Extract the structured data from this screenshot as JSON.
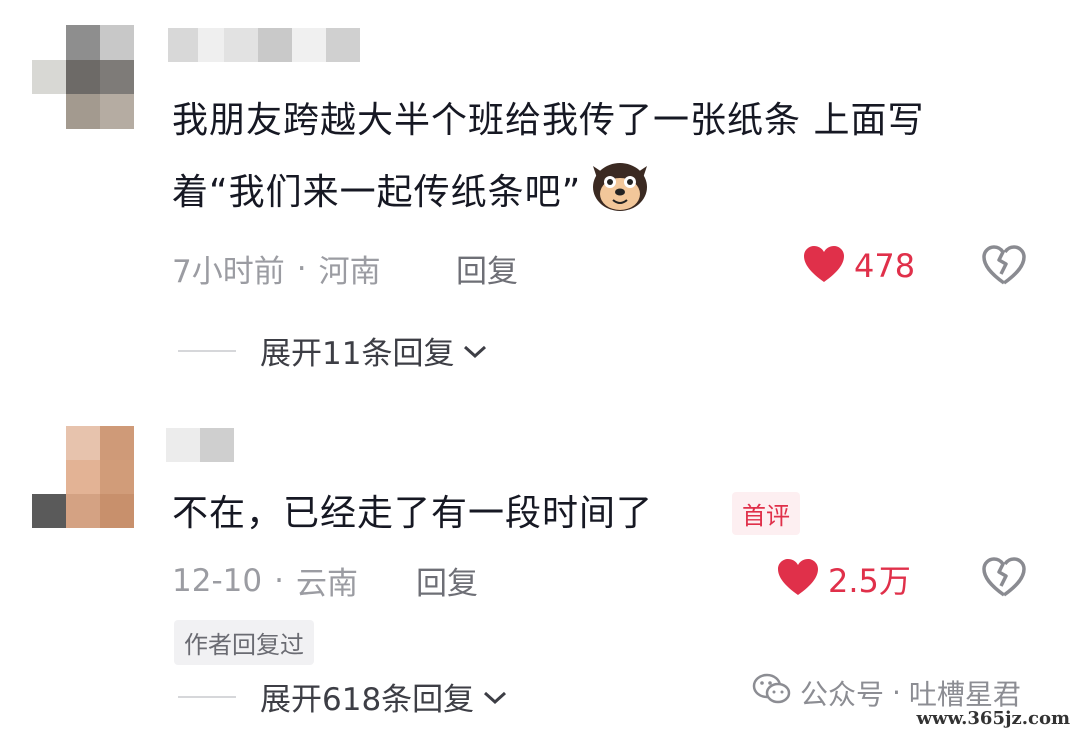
{
  "comments": [
    {
      "text_line1": "我朋友跨越大半个班给我传了一张纸条 上面写",
      "text_line2": "着“我们来一起传纸条吧”",
      "emoji": "dog-emoji",
      "time": "7小时前",
      "location": "河南",
      "reply_label": "回复",
      "likes": "478",
      "expand_label": "展开11条回复"
    },
    {
      "text": "不在，已经走了有一段时间了",
      "badge": "首评",
      "time": "12-10",
      "location": "云南",
      "reply_label": "回复",
      "likes": "2.5万",
      "author_tag": "作者回复过",
      "expand_label": "展开618条回复"
    }
  ],
  "meta_separator": "·",
  "watermark": {
    "label": "公众号",
    "separator": "·",
    "name": "吐槽星君",
    "site": "www.365jz.com"
  },
  "colors": {
    "like_red": "#e0304a",
    "meta_gray": "#9b9ca2"
  },
  "icons": [
    "heart-filled-icon",
    "broken-heart-icon",
    "chevron-down-icon",
    "wechat-icon"
  ]
}
